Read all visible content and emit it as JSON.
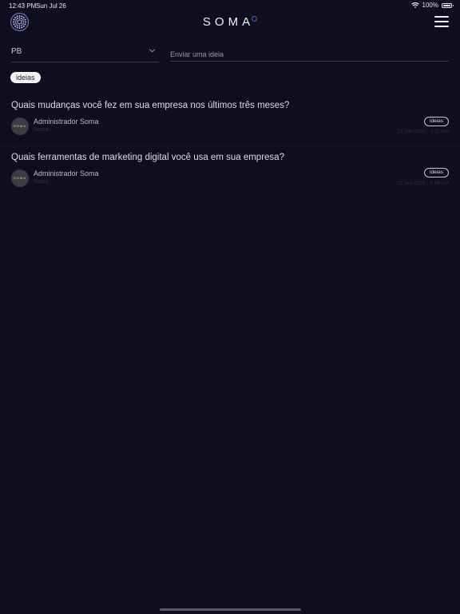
{
  "status_bar": {
    "time": "12:43 PM",
    "date": "Sun Jul 26",
    "battery": "100%"
  },
  "header": {
    "brand": "SOMA"
  },
  "filters": {
    "select_value": "PB",
    "idea_placeholder": "Enviar uma ideia"
  },
  "active_chip": "ideias",
  "posts": [
    {
      "question": "Quais mudanças você fez em sua empresa nos últimos três meses?",
      "avatar_text": "SOMA",
      "author": "Administrador  Soma",
      "sub": "Soma",
      "tag": "ideias",
      "datetime": "23 Jun 2020 - 3:11 AM"
    },
    {
      "question": "Quais ferramentas de marketing digital você usa em sua empresa?",
      "avatar_text": "SOMA",
      "author": "Administrador  Soma",
      "sub": "Soma",
      "tag": "ideias",
      "datetime": "23 Jun 2020 - 3:08 AM"
    }
  ],
  "icons": {
    "logo": "dotted-circle-logo-icon",
    "menu": "hamburger-menu-icon",
    "chevron": "chevron-down-icon",
    "wifi": "wifi-icon",
    "battery": "battery-icon"
  },
  "colors": {
    "background": "#0e0e1e",
    "brand_accent": "#4f5bd9"
  }
}
